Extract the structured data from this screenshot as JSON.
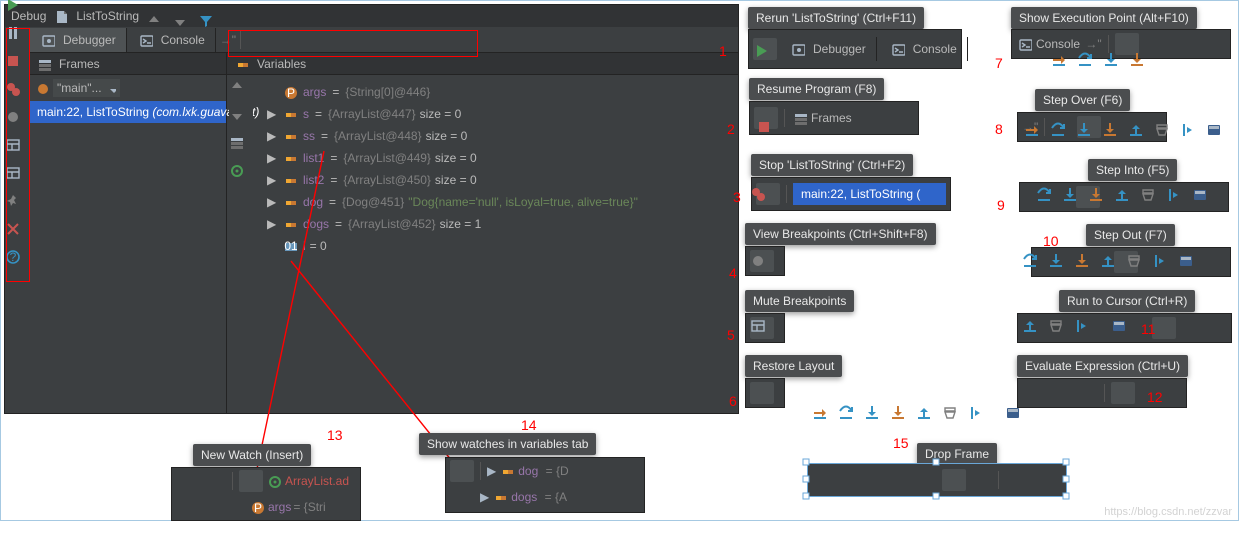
{
  "title": {
    "debug": "Debug",
    "config": "ListToString"
  },
  "tabs": {
    "debugger": "Debugger",
    "console": "Console"
  },
  "panes": {
    "frames": "Frames",
    "variables": "Variables"
  },
  "thread": {
    "label": "\"main\"..."
  },
  "stack": {
    "entry_text": "main:22, ListToString ",
    "entry_pkg_italic": "(com.lxk.guavaTest)"
  },
  "vars": {
    "rows": [
      {
        "badge": "param",
        "name": "args",
        "ref": "{String[0]@446}",
        "extra": ""
      },
      {
        "badge": "field",
        "twisty": "▶",
        "name": "s",
        "ref": "{ArrayList@447}",
        "extra": "  size = 0"
      },
      {
        "badge": "field",
        "twisty": "▶",
        "name": "ss",
        "ref": "{ArrayList@448}",
        "extra": "  size = 0"
      },
      {
        "badge": "field",
        "twisty": "▶",
        "name": "list1",
        "ref": "{ArrayList@449}",
        "extra": "  size = 0"
      },
      {
        "badge": "field",
        "twisty": "▶",
        "name": "list2",
        "ref": "{ArrayList@450}",
        "extra": "  size = 0"
      },
      {
        "badge": "field",
        "twisty": "▶",
        "name": "dog",
        "ref": "{Dog@451}",
        "str": " \"Dog{name='null', isLoyal=true, alive=true}\""
      },
      {
        "badge": "field",
        "twisty": "▶",
        "name": "dogs",
        "ref": "{ArrayList@452}",
        "extra": "  size = 1"
      },
      {
        "badge": "int",
        "name": "i",
        "extra": " = 0"
      }
    ]
  },
  "tooltips": {
    "t1": "Rerun 'ListToString' (Ctrl+F11)",
    "t2": "Resume Program (F8)",
    "t3": "Stop 'ListToString' (Ctrl+F2)",
    "t4": "View Breakpoints (Ctrl+Shift+F8)",
    "t5": "Mute Breakpoints",
    "t6": "Restore Layout",
    "t7": "Show Execution Point (Alt+F10)",
    "t8": "Step Over (F6)",
    "t9": "Step Into (F5)",
    "t10": "Step Out (F7)",
    "t11": "Run to Cursor (Ctrl+R)",
    "t12": "Evaluate Expression (Ctrl+U)",
    "t13": "New Watch (Insert)",
    "t14": "Show watches in variables tab",
    "t15": "Drop Frame"
  },
  "annotations": {
    "n1": "1",
    "n2": "2",
    "n3": "3",
    "n4": "4",
    "n5": "5",
    "n6": "6",
    "n7": "7",
    "n8": "8",
    "n9": "9",
    "n10": "10",
    "n11": "11",
    "n12": "12",
    "n13": "13",
    "n14": "14",
    "n15": "15"
  },
  "mini13": {
    "row1": "ArrayList.ad",
    "row2": "args",
    "row2b": "= {Stri"
  },
  "mini14": {
    "r1": "dog",
    "r1b": "= {D",
    "r2": "dogs",
    "r2b": "= {A"
  },
  "frag3_frame": "main:22, ListToString (",
  "watermark": "https://blog.csdn.net/zzvar"
}
